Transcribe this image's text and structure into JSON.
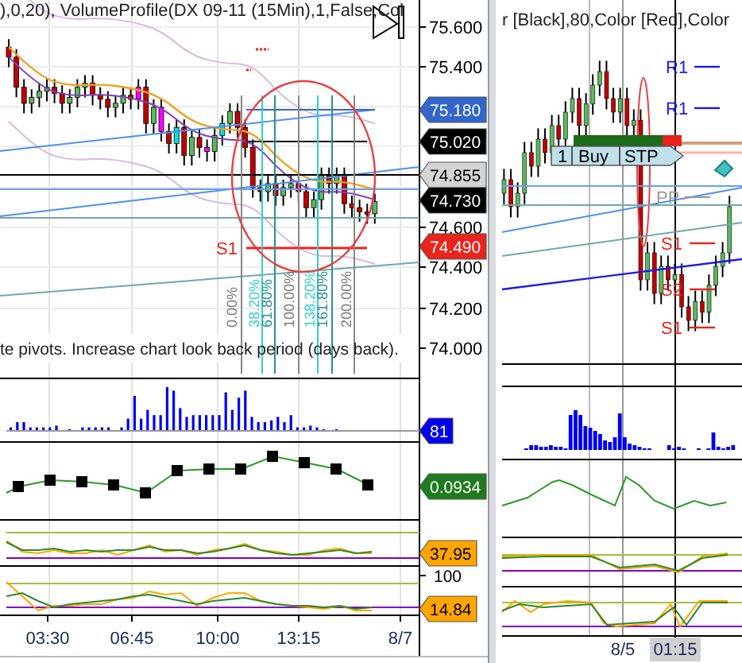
{
  "left_chart": {
    "header": "),0,20), VolumeProfile(DX 09-11 (15Min),1,False,Col",
    "price_axis_ticks": [
      "75.600",
      "75.400",
      "74.600",
      "74.400",
      "74.200",
      "74.000"
    ],
    "value_tags": [
      {
        "text": "75.180",
        "color": "#3366cc"
      },
      {
        "text": "75.020",
        "color": "#000000"
      },
      {
        "text": "74.855",
        "color": "#d4d4d4"
      },
      {
        "text": "74.730",
        "color": "#000000"
      },
      {
        "text": "74.490",
        "color": "#e8241c"
      },
      {
        "text": "81",
        "color": "#0000ee"
      },
      {
        "text": "0.0934",
        "color": "#1e7b1e"
      },
      {
        "text": "37.95",
        "color": "#ffa500"
      },
      {
        "text": "14.84",
        "color": "#ffa500"
      }
    ],
    "pivot_labels": [
      {
        "text": "S1",
        "color": "#e8241c"
      }
    ],
    "fib_labels": [
      "0.00%",
      "38.20%",
      "61.80%",
      "100.00%",
      "138.20%",
      "161.80%",
      "200.00%"
    ],
    "message": "te pivots. Increase chart look back period (days back).",
    "stoch_tick": "100",
    "time_labels": [
      "03:30",
      "06:45",
      "10:00",
      "13:15",
      "8/7"
    ]
  },
  "right_chart": {
    "header": "r [Black],80,Color [Red],Color",
    "pivot_labels": [
      {
        "text": "R1",
        "color": "#1a1aee"
      },
      {
        "text": "R1",
        "color": "#1a1aee"
      },
      {
        "text": "PP",
        "color": "#999999"
      },
      {
        "text": "S1",
        "color": "#e8241c"
      },
      {
        "text": "S2",
        "color": "#e8241c"
      },
      {
        "text": "S1",
        "color": "#e8241c"
      }
    ],
    "order_tag": {
      "quantity": "1",
      "side": "Buy",
      "type": "STP"
    },
    "time_labels": [
      "8/5",
      "01:15"
    ]
  }
}
